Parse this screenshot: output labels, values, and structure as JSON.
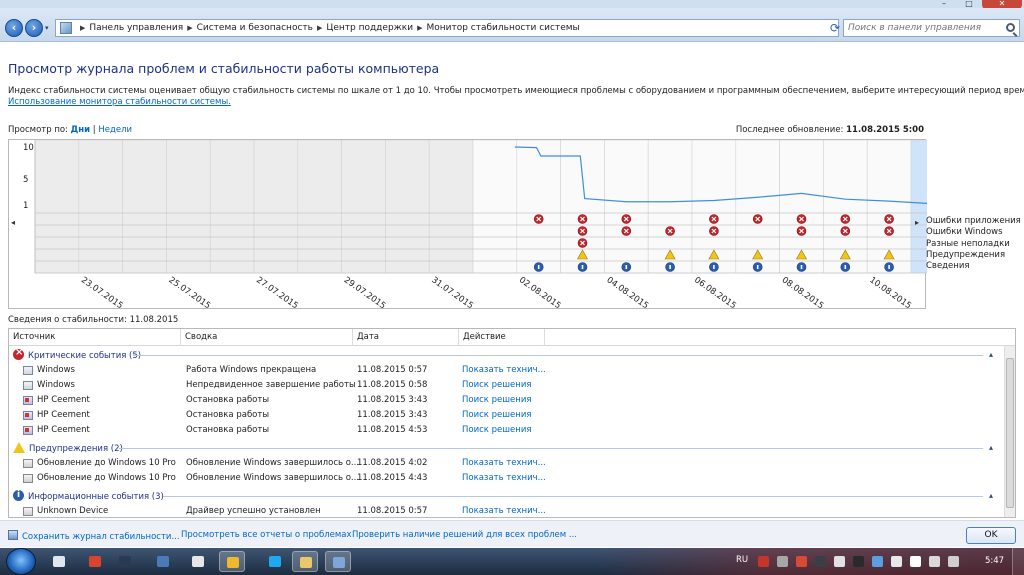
{
  "window": {
    "controls": {
      "min": "–",
      "max": "□",
      "close": "✕"
    }
  },
  "address": {
    "crumbs": [
      "Панель управления",
      "Система и безопасность",
      "Центр поддержки",
      "Монитор стабильности системы"
    ],
    "search_placeholder": "Поиск в панели управления"
  },
  "header": {
    "title": "Просмотр журнала проблем и стабильности работы компьютера",
    "description": "Индекс стабильности системы оценивает общую стабильность системы по шкале от 1 до 10. Чтобы просмотреть имеющиеся проблемы с оборудованием и программным обеспечением, выберите интересующий период времени.",
    "learn_link": "Использование монитора стабильности системы.",
    "view_by_label": "Просмотр по:",
    "view_days": "Дни",
    "view_sep": "|",
    "view_weeks": "Недели",
    "last_update_label": "Последнее обновление:",
    "last_update_value": "11.08.2015 5:00"
  },
  "chart_data": {
    "type": "line",
    "y_ticks": [
      "10",
      "5",
      "1"
    ],
    "dates": [
      "22.07",
      "23.07",
      "24.07",
      "25.07",
      "26.07",
      "27.07",
      "28.07",
      "29.07",
      "30.07",
      "31.07",
      "01.08",
      "02.08",
      "03.08",
      "04.08",
      "05.08",
      "06.08",
      "07.08",
      "08.08",
      "09.08",
      "10.08",
      "11.08"
    ],
    "x_tick_labels": [
      "23.07.2015",
      "25.07.2015",
      "27.07.2015",
      "29.07.2015",
      "31.07.2015",
      "02.08.2015",
      "04.08.2015",
      "06.08.2015",
      "08.08.2015",
      "10.08.2015"
    ],
    "x_tick_label_dates": [
      "23.07",
      "25.07",
      "27.07",
      "29.07",
      "31.07",
      "02.08",
      "04.08",
      "06.08",
      "08.08",
      "10.08"
    ],
    "stability_index": [
      {
        "date": "01.08",
        "value": 10
      },
      {
        "date": "02.08",
        "value": 9.9
      },
      {
        "date": "02.08",
        "value": 8.6
      },
      {
        "date": "03.08",
        "value": 8.6
      },
      {
        "date": "03.08",
        "value": 2.0
      },
      {
        "date": "04.08",
        "value": 1.5
      },
      {
        "date": "05.08",
        "value": 1.5
      },
      {
        "date": "06.08",
        "value": 1.7
      },
      {
        "date": "07.08",
        "value": 2.2
      },
      {
        "date": "08.08",
        "value": 2.8
      },
      {
        "date": "09.08",
        "value": 1.9
      },
      {
        "date": "10.08",
        "value": 1.6
      },
      {
        "date": "11.08",
        "value": 1.2
      }
    ],
    "ylim": [
      0,
      10
    ],
    "selected_date": "11.08",
    "event_rows": [
      "Ошибки приложения",
      "Ошибки Windows",
      "Разные неполадки",
      "Предупреждения",
      "Сведения"
    ],
    "events": {
      "app_errors": [
        "02.08",
        "03.08",
        "04.08",
        "06.08",
        "07.08",
        "08.08",
        "09.08",
        "10.08",
        "11.08"
      ],
      "windows_errors": [
        "03.08",
        "04.08",
        "05.08",
        "06.08",
        "08.08",
        "09.08",
        "10.08",
        "11.08"
      ],
      "misc": [
        "03.08"
      ],
      "warnings": [
        "03.08",
        "05.08",
        "06.08",
        "07.08",
        "08.08",
        "09.08",
        "10.08",
        "11.08"
      ],
      "info": [
        "02.08",
        "03.08",
        "04.08",
        "05.08",
        "06.08",
        "07.08",
        "08.08",
        "09.08",
        "10.08",
        "11.08"
      ]
    },
    "colors": {
      "line": "#3d8ee0",
      "selected": "#cfe3fa",
      "weekend": "#ececec",
      "error": "#c1272d",
      "warning": "#f2c418",
      "info": "#2a5db0"
    }
  },
  "details": {
    "title": "Сведения о стабильности: 11.08.2015",
    "columns": [
      "Источник",
      "Сводка",
      "Дата",
      "Действие"
    ],
    "groups": [
      {
        "label": "Критические события (5)",
        "icon": "error-icon",
        "rows": [
          {
            "icon": "windows",
            "source": "Windows",
            "summary": "Работа Windows прекращена",
            "date": "11.08.2015 0:57",
            "action": "Показать технич..."
          },
          {
            "icon": "windows",
            "source": "Windows",
            "summary": "Непредвиденное завершение работы",
            "date": "11.08.2015 0:58",
            "action": "Поиск решения"
          },
          {
            "icon": "hp",
            "source": "HP Ceement",
            "summary": "Остановка работы",
            "date": "11.08.2015 3:43",
            "action": "Поиск решения"
          },
          {
            "icon": "hp",
            "source": "HP Ceement",
            "summary": "Остановка работы",
            "date": "11.08.2015 3:43",
            "action": "Поиск решения"
          },
          {
            "icon": "hp",
            "source": "HP Ceement",
            "summary": "Остановка работы",
            "date": "11.08.2015 4:53",
            "action": "Поиск решения"
          }
        ]
      },
      {
        "label": "Предупреждения (2)",
        "icon": "warning-icon",
        "rows": [
          {
            "icon": "update",
            "source": "Обновление до Windows 10 Pro",
            "summary": "Обновление Windows завершилось о...",
            "date": "11.08.2015 4:02",
            "action": "Показать технич..."
          },
          {
            "icon": "update",
            "source": "Обновление до Windows 10 Pro",
            "summary": "Обновление Windows завершилось о...",
            "date": "11.08.2015 4:43",
            "action": "Показать технич..."
          }
        ]
      },
      {
        "label": "Информационные события (3)",
        "icon": "info-icon",
        "rows": [
          {
            "icon": "device",
            "source": "Unknown Device",
            "summary": "Драйвер успешно установлен",
            "date": "11.08.2015 0:57",
            "action": "Показать технич..."
          }
        ]
      }
    ]
  },
  "footer": {
    "save_link": "Сохранить журнал стабильности...",
    "reports_link": "Просмотреть все отчеты о проблемах",
    "check_link": "Проверить наличие решений для всех проблем ...",
    "ok_label": "OK"
  },
  "taskbar": {
    "lang": "RU",
    "time": "5:47",
    "apps": [
      "media-player",
      "opera",
      "steam",
      "tool",
      "headset",
      "chrome",
      "skype",
      "folder",
      "control-panel"
    ],
    "app_colors": [
      "#e0e6ee",
      "#d8442c",
      "#2a3a52",
      "#4a7ab8",
      "#e6e6e6",
      "#f0b82c",
      "#1eaaf0",
      "#e9c86a",
      "#7ea6d8"
    ]
  }
}
